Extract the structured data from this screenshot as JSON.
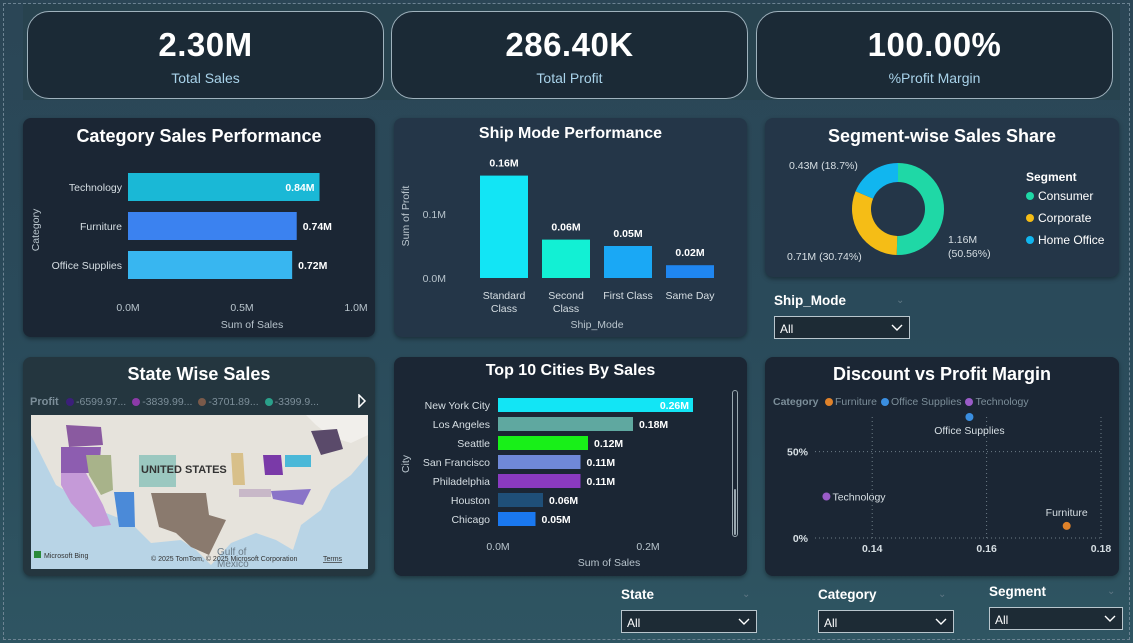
{
  "kpis": [
    {
      "value": "2.30M",
      "label": "Total Sales"
    },
    {
      "value": "286.40K",
      "label": "Total Profit"
    },
    {
      "value": "100.00%",
      "label": "%Profit Margin"
    }
  ],
  "titles": {
    "category": "Category Sales Performance",
    "ship": "Ship Mode Performance",
    "segment": "Segment-wise Sales Share",
    "state": "State Wise Sales",
    "cities": "Top 10 Cities By Sales",
    "discount": "Discount vs Profit Margin"
  },
  "map": {
    "legend_title": "Profit",
    "legend_items": [
      {
        "label": "-6599.97...",
        "color": "#3b1f7a"
      },
      {
        "label": "-3839.99...",
        "color": "#8c3aa8"
      },
      {
        "label": "-3701.89...",
        "color": "#7a5a4a"
      },
      {
        "label": "-3399.9...",
        "color": "#2aa08a"
      }
    ],
    "country_label": "UNITED STATES",
    "gulf_label": "Gulf of",
    "mexico_label": "Mexico",
    "bing_label": "Microsoft Bing",
    "copyright": "© 2025 TomTom, © 2025 Microsoft Corporation",
    "terms": "Terms",
    "land_color": "#e6e3dc",
    "water_color": "#b8d4e6"
  },
  "slicers": {
    "ship_mode": {
      "title": "Ship_Mode",
      "value": "All"
    },
    "state": {
      "title": "State",
      "value": "All"
    },
    "category": {
      "title": "Category",
      "value": "All"
    },
    "segment": {
      "title": "Segment",
      "value": "All"
    }
  },
  "chart_data": [
    {
      "id": "category",
      "type": "bar",
      "orientation": "horizontal",
      "title": "Category Sales Performance",
      "categories": [
        "Technology",
        "Furniture",
        "Office Supplies"
      ],
      "values": [
        0.84,
        0.74,
        0.72
      ],
      "value_labels": [
        "0.84M",
        "0.74M",
        "0.72M"
      ],
      "colors": [
        "#1ab8d6",
        "#3b82f0",
        "#38b6f0"
      ],
      "xlim": [
        0,
        1.0
      ],
      "xticks": [
        "0.0M",
        "0.5M",
        "1.0M"
      ],
      "xlabel": "Sum of Sales",
      "ylabel": "Category"
    },
    {
      "id": "ship",
      "type": "bar",
      "title": "Ship Mode Performance",
      "categories": [
        "Standard Class",
        "Second Class",
        "First Class",
        "Same Day"
      ],
      "category_lines": [
        [
          "Standard",
          "Class"
        ],
        [
          "Second",
          "Class"
        ],
        [
          "First Class"
        ],
        [
          "Same Day"
        ]
      ],
      "values": [
        0.16,
        0.06,
        0.05,
        0.02
      ],
      "value_labels": [
        "0.16M",
        "0.06M",
        "0.05M",
        "0.02M"
      ],
      "colors": [
        "#12e5f5",
        "#12f0d4",
        "#1aa8f5",
        "#1f86f0"
      ],
      "ylim": [
        0,
        0.2
      ],
      "yticks": [
        {
          "v": 0,
          "label": "0.0M"
        },
        {
          "v": 0.1,
          "label": "0.1M"
        }
      ],
      "xlabel": "Ship_Mode",
      "ylabel": "Sum of Profit"
    },
    {
      "id": "segment",
      "type": "pie",
      "title": "Segment-wise Sales Share",
      "legend_title": "Segment",
      "slices": [
        {
          "name": "Consumer",
          "value": 1.16,
          "pct": 50.56,
          "label": [
            "1.16M",
            "(50.56%)"
          ],
          "color": "#1fd8a6"
        },
        {
          "name": "Corporate",
          "value": 0.71,
          "pct": 30.74,
          "label": [
            "0.71M (30.74%)"
          ],
          "color": "#f5bd16"
        },
        {
          "name": "Home Office",
          "value": 0.43,
          "pct": 18.7,
          "label": [
            "0.43M (18.7%)"
          ],
          "color": "#11b6ef"
        }
      ]
    },
    {
      "id": "cities",
      "type": "bar",
      "orientation": "horizontal",
      "title": "Top 10 Cities By Sales",
      "categories": [
        "New York City",
        "Los Angeles",
        "Seattle",
        "San Francisco",
        "Philadelphia",
        "Houston",
        "Chicago"
      ],
      "values": [
        0.26,
        0.18,
        0.12,
        0.11,
        0.11,
        0.06,
        0.05
      ],
      "value_labels": [
        "0.26M",
        "0.18M",
        "0.12M",
        "0.11M",
        "0.11M",
        "0.06M",
        "0.05M"
      ],
      "colors": [
        "#12e5f5",
        "#5fa8a0",
        "#18f018",
        "#6f88d8",
        "#8a3ac0",
        "#1f4f78",
        "#1a78f0"
      ],
      "xlim": [
        0,
        0.28
      ],
      "xticks": [
        {
          "v": 0,
          "label": "0.0M"
        },
        {
          "v": 0.2,
          "label": "0.2M"
        }
      ],
      "xlabel": "Sum of Sales",
      "ylabel": "City"
    },
    {
      "id": "discount",
      "type": "scatter",
      "title": "Discount vs Profit Margin",
      "legend_title": "Category",
      "xlim": [
        0.13,
        0.18
      ],
      "ylim": [
        0,
        0.7
      ],
      "xticks": [
        {
          "v": 0.14,
          "label": "0.14"
        },
        {
          "v": 0.16,
          "label": "0.16"
        },
        {
          "v": 0.18,
          "label": "0.18"
        }
      ],
      "yticks": [
        {
          "v": 0,
          "label": "0%"
        },
        {
          "v": 0.5,
          "label": "50%"
        }
      ],
      "points": [
        {
          "name": "Furniture",
          "x": 0.174,
          "y": 0.07,
          "color": "#e0822a"
        },
        {
          "name": "Office Supplies",
          "x": 0.157,
          "y": 0.7,
          "color": "#3a8ee0"
        },
        {
          "name": "Technology",
          "x": 0.132,
          "y": 0.24,
          "color": "#9a5cc8"
        }
      ]
    }
  ]
}
